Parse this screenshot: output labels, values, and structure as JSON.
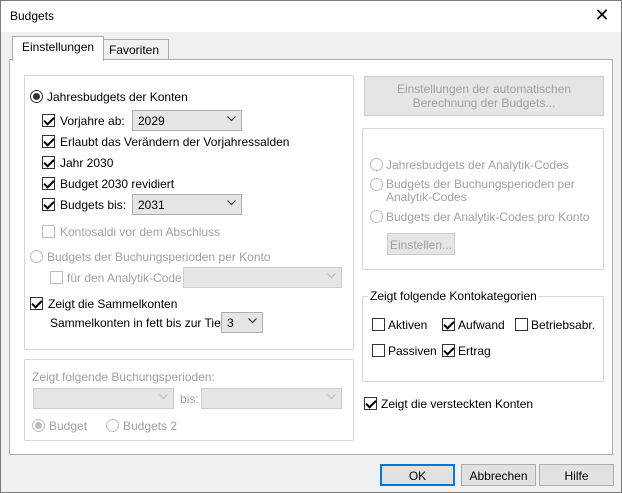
{
  "window": {
    "title": "Budgets",
    "close_glyph": "✕"
  },
  "tabs": [
    {
      "label": "Einstellungen",
      "active": true
    },
    {
      "label": "Favoriten",
      "active": false
    }
  ],
  "left": {
    "yearly_label": "Jahresbudgets der Konten",
    "prev_years_label": "Vorjahre ab:",
    "prev_years_value": "2029",
    "allow_change_label": "Erlaubt das Verändern der Vorjahressalden",
    "year2030_label": "Jahr 2030",
    "budget2030_label": "Budget 2030 revidiert",
    "budgets_until_label": "Budgets bis:",
    "budgets_until_value": "2031",
    "kontosaldi_label": "Kontosaldi vor dem Abschluss",
    "periods_label": "Budgets der Buchungsperioden per Konto",
    "analytic_code_label": "für den Analytik-Code:",
    "analytic_code_value": "",
    "show_summary_label": "Zeigt die Sammelkonten",
    "bold_depth_label": "Sammelkonten in fett bis zur Tiefe:",
    "bold_depth_value": "3"
  },
  "periods_group": {
    "legend": "Zeigt folgende Buchungsperioden:",
    "from_value": "",
    "to_label": "bis:",
    "to_value": "",
    "budget_label": "Budget",
    "budget2_label": "Budgets 2"
  },
  "right": {
    "auto_calc_button": "Einstellungen der automatischen\nBerechnung der Budgets...",
    "analytic_yearly_label": "Jahresbudgets der Analytik-Codes",
    "analytic_periods_label": "Budgets der Buchungsperioden per\nAnalytik-Codes",
    "analytic_per_account_label": "Budgets der Analytik-Codes pro Konto",
    "configure_button": "Einstellen..."
  },
  "categories_group": {
    "legend": "Zeigt folgende Kontokategorien",
    "items": [
      {
        "label": "Aktiven",
        "checked": false
      },
      {
        "label": "Aufwand",
        "checked": true
      },
      {
        "label": "Betriebsabr.",
        "checked": false
      },
      {
        "label": "Passiven",
        "checked": false
      },
      {
        "label": "Ertrag",
        "checked": true
      }
    ]
  },
  "show_hidden_label": "Zeigt die versteckten Konten",
  "footer": {
    "ok": "OK",
    "cancel": "Abbrechen",
    "help": "Hilfe"
  },
  "colors": {
    "default_button_border": "#0078d7",
    "disabled_text": "#a0a0a0"
  }
}
